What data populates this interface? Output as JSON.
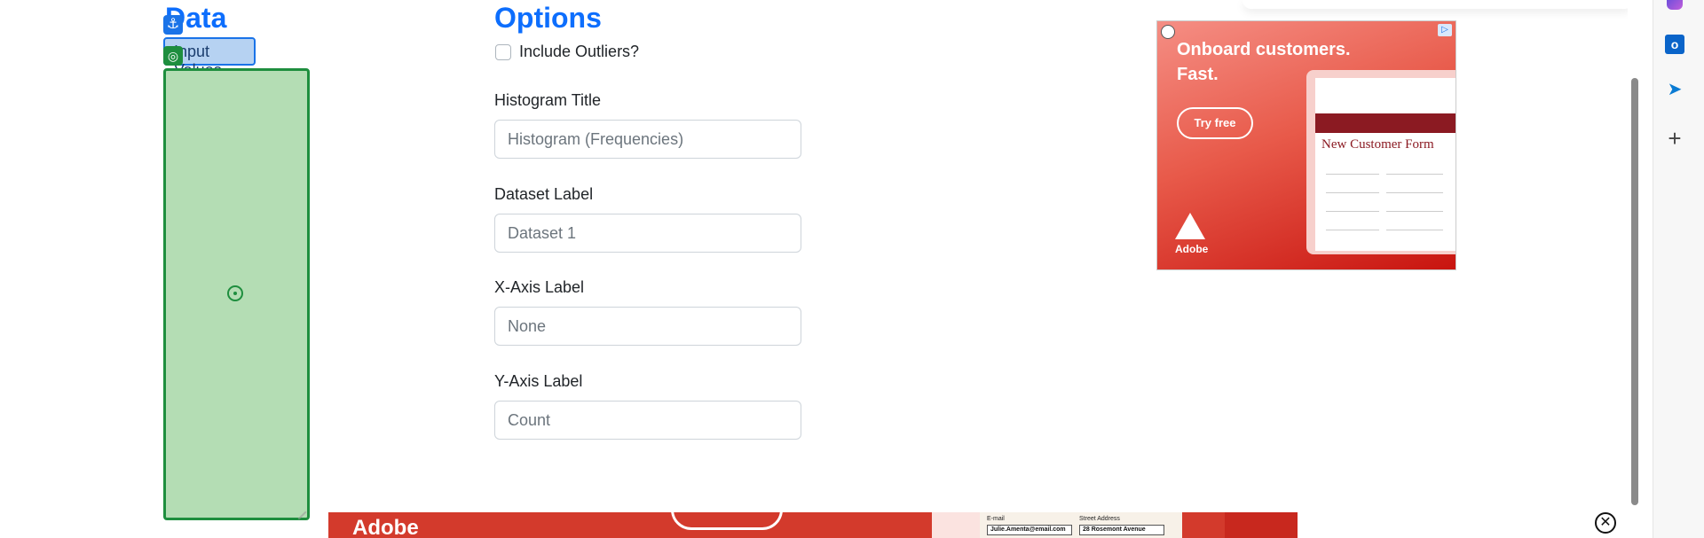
{
  "data_section": {
    "title": "Data",
    "input_label": "Input Values",
    "input_value": ""
  },
  "options_section": {
    "title": "Options",
    "outliers_label": "Include Outliers?",
    "outliers_checked": false,
    "fields": [
      {
        "label": "Histogram Title",
        "placeholder": "Histogram (Frequencies)",
        "value": ""
      },
      {
        "label": "Dataset Label",
        "placeholder": "Dataset 1",
        "value": ""
      },
      {
        "label": "X-Axis Label",
        "placeholder": "None",
        "value": ""
      },
      {
        "label": "Y-Axis Label",
        "placeholder": "Count",
        "value": ""
      }
    ]
  },
  "ad_top": {
    "headline": "Onboard customers. Fast.",
    "cta": "Try free",
    "form_title": "New Customer Form",
    "brand": "Adobe",
    "bg_color": "#e85a4a"
  },
  "ad_bottom": {
    "brand": "Adobe",
    "email_label": "E-mail",
    "email_value": "Julie.Amenta@email.com",
    "street_label": "Street Address",
    "street_value": "28 Rosemont Avenue"
  },
  "edge_sidebar": {
    "icons": [
      "copilot-icon",
      "outlook-icon",
      "send-icon",
      "add-icon"
    ]
  },
  "colors": {
    "accent": "#0d6efd",
    "selection_green": "#1e8e3e",
    "selection_blue": "#1a73e8"
  }
}
